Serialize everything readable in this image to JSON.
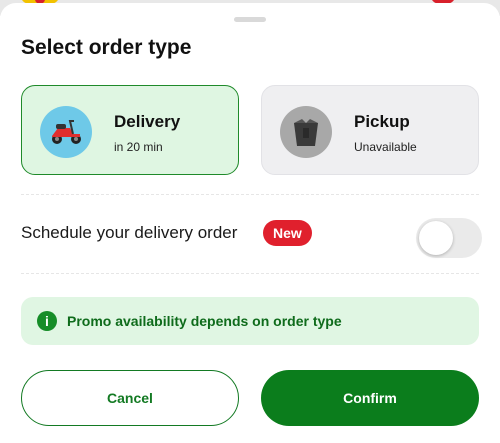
{
  "colors": {
    "accent": "#0b7d1c",
    "selected_bg": "#dff6e2",
    "badge": "#e0202d",
    "info_bg": "#e0f6e3"
  },
  "sheet": {
    "title": "Select order type"
  },
  "order_types": [
    {
      "label": "Delivery",
      "sub": "in 20 min",
      "icon": "scooter-icon",
      "selected": true
    },
    {
      "label": "Pickup",
      "sub": "Unavailable",
      "icon": "bag-icon",
      "selected": false
    }
  ],
  "schedule": {
    "label": "Schedule your delivery order",
    "badge": "New",
    "toggle_on": false
  },
  "info": {
    "icon_glyph": "i",
    "text": "Promo availability depends on order type"
  },
  "actions": {
    "cancel_label": "Cancel",
    "confirm_label": "Confirm"
  }
}
